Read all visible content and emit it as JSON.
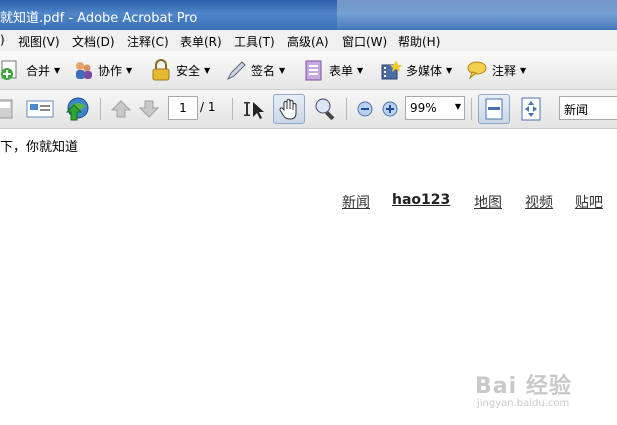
{
  "window": {
    "title": "就知道.pdf - Adobe Acrobat Pro"
  },
  "menu": [
    ")",
    "视图(V)",
    "文档(D)",
    "注释(C)",
    "表单(R)",
    "工具(T)",
    "高级(A)",
    "窗口(W)",
    "帮助(H)"
  ],
  "toolbar_tasks": {
    "merge": "合并",
    "collaborate": "协作",
    "secure": "安全",
    "sign": "签名",
    "forms": "表单",
    "multimedia": "多媒体",
    "comment": "注释"
  },
  "navigation": {
    "page_current": "1",
    "page_total": "/ 1"
  },
  "zoom": {
    "value": "99%"
  },
  "search": {
    "value": "新闻"
  },
  "document": {
    "text": "下，你就知道",
    "links": [
      "新闻",
      "hao123",
      "地图",
      "视频",
      "贴吧"
    ]
  },
  "watermark": {
    "line1": "Bai 经验",
    "line2": "jingyan.baidu.com"
  },
  "colors": {
    "titlebar": "#3a6fb5",
    "menubar": "#f0f0f0",
    "toolbar": "#e6e6e6"
  }
}
